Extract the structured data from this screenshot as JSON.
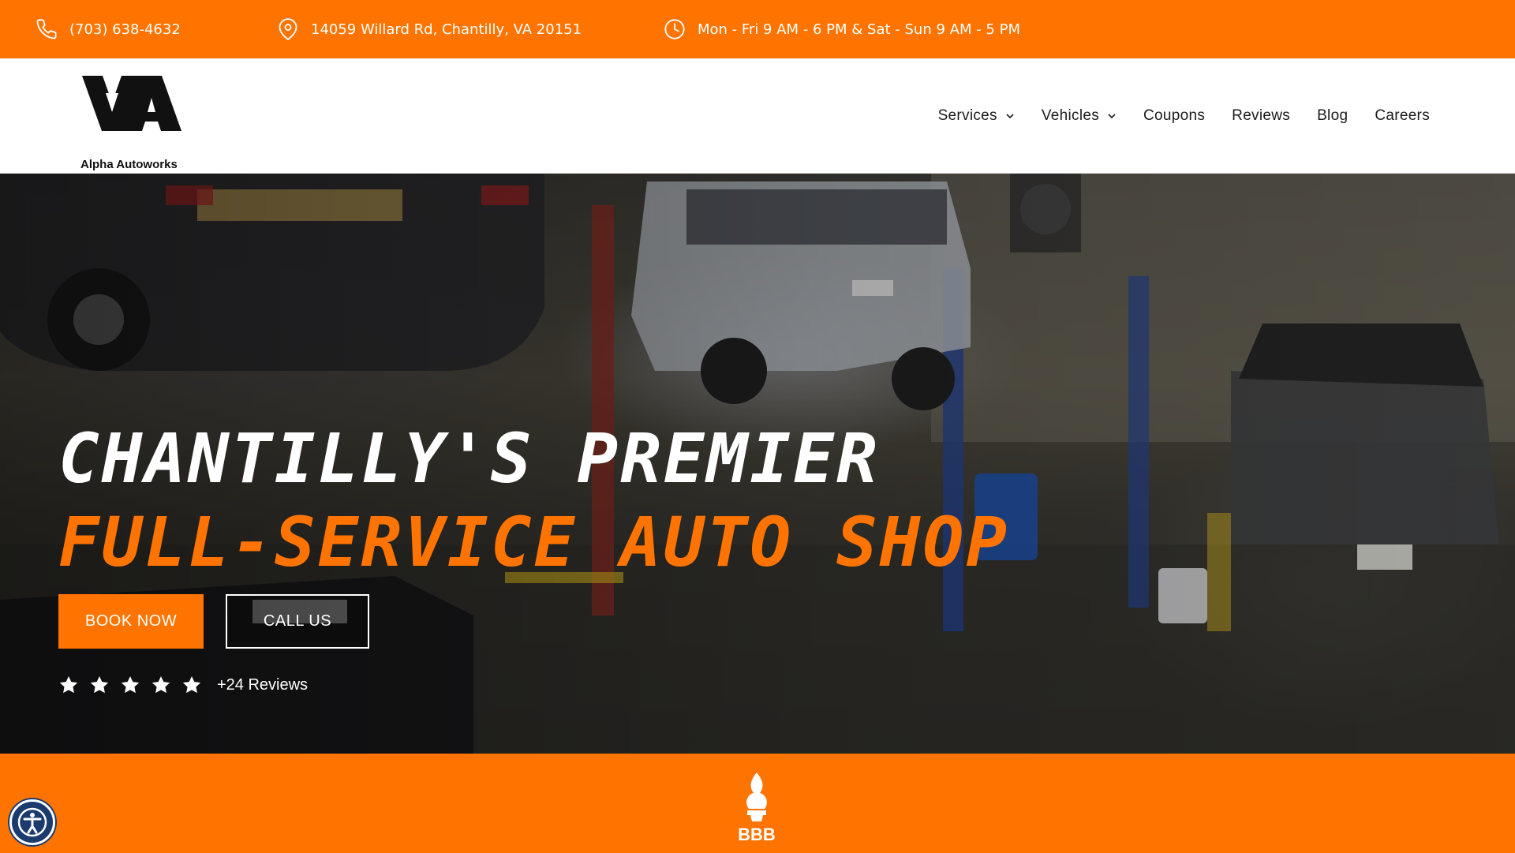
{
  "topbar": {
    "phone": "(703) 638-4632",
    "address": "14059 Willard Rd, Chantilly, VA 20151",
    "hours": "Mon - Fri 9 AM - 6 PM & Sat - Sun 9 AM - 5 PM",
    "icons": [
      "phone-icon",
      "map-pin-icon",
      "clock-icon"
    ]
  },
  "header": {
    "logo_text": "Alpha Autoworks",
    "nav": [
      {
        "label": "Services",
        "has_dropdown": true
      },
      {
        "label": "Vehicles",
        "has_dropdown": true
      },
      {
        "label": "Coupons",
        "has_dropdown": false
      },
      {
        "label": "Reviews",
        "has_dropdown": false
      },
      {
        "label": "Blog",
        "has_dropdown": false
      },
      {
        "label": "Careers",
        "has_dropdown": false
      }
    ]
  },
  "hero": {
    "headline": "CHANTILLY'S PREMIER",
    "subheadline": "FULL-SERVICE AUTO SHOP",
    "book_label": "BOOK NOW",
    "call_label": "CALL US",
    "rating_stars": 5,
    "reviews_text": "+24 Reviews"
  },
  "band": {
    "badge": "BBB"
  },
  "colors": {
    "accent": "#ff7400",
    "text_dark": "#1b1b1b",
    "accessibility_blue": "#1b3b6f"
  }
}
